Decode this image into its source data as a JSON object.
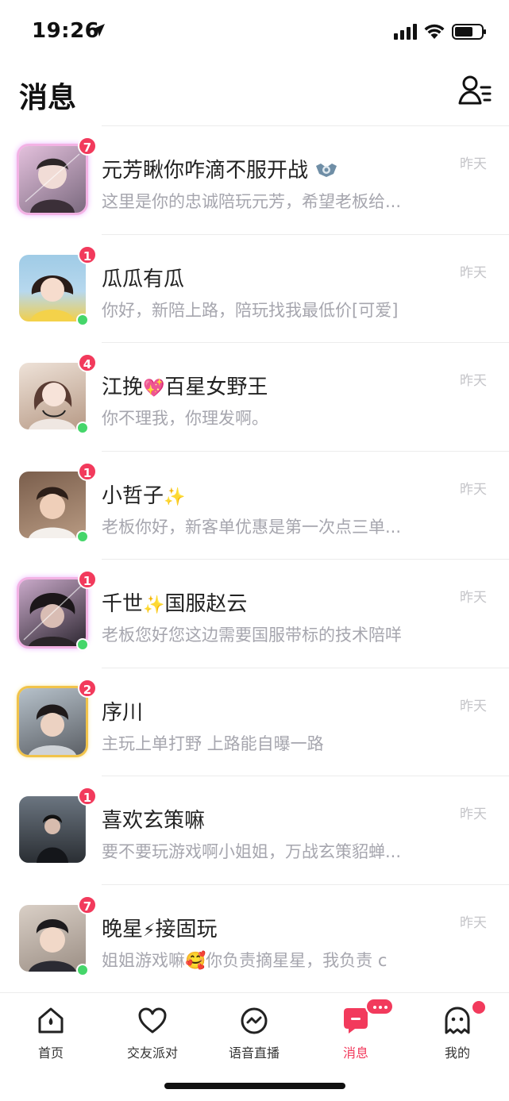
{
  "status_bar": {
    "time": "19:26"
  },
  "header": {
    "title": "消息"
  },
  "conversations": [
    {
      "name": "元芳瞅你咋滴不服开战",
      "preview": "这里是你的忠诚陪玩元芳，希望老板给...",
      "time": "昨天",
      "unread": "7",
      "online": false,
      "frame": "pink",
      "colors": [
        "#d9b3cf",
        "#7b6a7f"
      ]
    },
    {
      "name": "瓜瓜有瓜",
      "preview": "你好，新陪上路，陪玩找我最低价[可爱]",
      "time": "昨天",
      "unread": "1",
      "online": true,
      "frame": "none",
      "colors": [
        "#9fcbe6",
        "#f2cf4b"
      ]
    },
    {
      "name_before": "江挽",
      "name_emoji": "💖",
      "name_after": "百星女野王",
      "preview": "你不理我，你理发啊。",
      "time": "昨天",
      "unread": "4",
      "online": true,
      "frame": "none",
      "colors": [
        "#e9dcd2",
        "#5a3c33"
      ]
    },
    {
      "name_before": "小哲子",
      "name_emoji": "✨",
      "name_after": "",
      "preview": "老板你好，新客单优惠是第一次点三单...",
      "time": "昨天",
      "unread": "1",
      "online": true,
      "frame": "none",
      "colors": [
        "#8a6a55",
        "#e7c3ad"
      ]
    },
    {
      "name_before": "千世",
      "name_emoji": "✨",
      "name_after": "国服赵云",
      "preview": "老板您好您这边需要国服带标的技术陪咩",
      "time": "昨天",
      "unread": "1",
      "online": true,
      "frame": "pink",
      "colors": [
        "#3c3440",
        "#c9a9c9"
      ]
    },
    {
      "name": "序川",
      "preview": "主玩上单打野 上路能自曝一路",
      "time": "昨天",
      "unread": "2",
      "online": false,
      "frame": "gold",
      "colors": [
        "#a7b3bd",
        "#4b4a4c"
      ]
    },
    {
      "name": "喜欢玄策嘛",
      "preview": "要不要玩游戏啊小姐姐，万战玄策貂蝉...",
      "time": "昨天",
      "unread": "1",
      "online": false,
      "frame": "none",
      "colors": [
        "#56606b",
        "#1f2227"
      ]
    },
    {
      "name_before": "晚星",
      "name_emoji": "⚡",
      "name_after": "接固玩",
      "preview_before": "姐姐游戏嘛",
      "preview_emoji": "🥰",
      "preview_after": "你负责摘星星，我负责 c",
      "time": "昨天",
      "unread": "7",
      "online": true,
      "frame": "none",
      "colors": [
        "#cbbfb3",
        "#2b2b33"
      ]
    }
  ],
  "tabs": [
    {
      "label": "首页",
      "icon": "home-icon",
      "active": false
    },
    {
      "label": "交友派对",
      "icon": "heart-icon",
      "active": false
    },
    {
      "label": "语音直播",
      "icon": "live-icon",
      "active": false
    },
    {
      "label": "消息",
      "icon": "message-icon",
      "active": true
    },
    {
      "label": "我的",
      "icon": "ghost-icon",
      "active": false
    }
  ],
  "colors": {
    "accent": "#f23a5c",
    "online": "#45d66a",
    "muted_text": "#a6a6ae"
  }
}
